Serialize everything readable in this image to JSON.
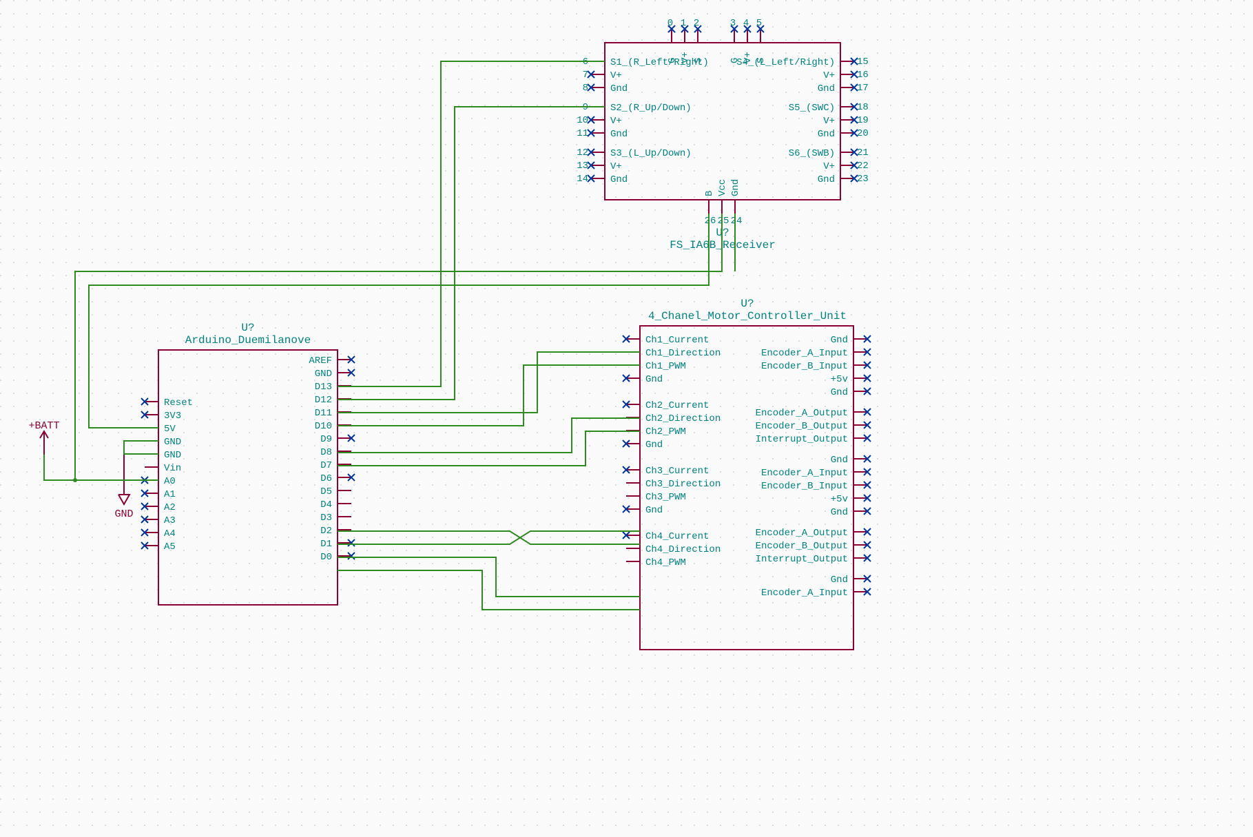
{
  "colors": {
    "bg": "#fafafa",
    "outline": "#8B0033",
    "pin_text": "#008080",
    "wire": "#2E8B1F",
    "nc": "#00349B"
  },
  "power_labels": {
    "batt": "+BATT",
    "gnd": "GND"
  },
  "components": {
    "arduino": {
      "ref": "U?",
      "value": "Arduino_Duemilanove",
      "left_pins": [
        "Reset",
        "3V3",
        "5V",
        "GND",
        "GND",
        "Vin",
        "A0",
        "A1",
        "A2",
        "A3",
        "A4",
        "A5"
      ],
      "right_pins": [
        "AREF",
        "GND",
        "D13",
        "D12",
        "D11",
        "D10",
        "D9",
        "D8",
        "D7",
        "D6",
        "D5",
        "D4",
        "D3",
        "D2",
        "D1",
        "D0"
      ]
    },
    "receiver": {
      "ref": "U?",
      "value": "FS_IA6B_Receiver",
      "top_labels_left": [
        "G",
        "V+",
        "S"
      ],
      "top_labels_right": [
        "G",
        "V+",
        "S"
      ],
      "top_pin_nums_left": [
        "0",
        "1",
        "2"
      ],
      "top_pin_nums_right": [
        "3",
        "4",
        "5"
      ],
      "bottom_labels": [
        "B",
        "Vcc",
        "Gnd"
      ],
      "bottom_pin_nums": [
        "26",
        "25",
        "24"
      ],
      "left_groups": [
        {
          "name": "S1_(R_Left/Right)",
          "num": "6"
        },
        {
          "name": "V+",
          "num": "7"
        },
        {
          "name": "Gnd",
          "num": "8"
        },
        {
          "name": "S2_(R_Up/Down)",
          "num": "9"
        },
        {
          "name": "V+",
          "num": "10"
        },
        {
          "name": "Gnd",
          "num": "11"
        },
        {
          "name": "S3_(L_Up/Down)",
          "num": "12"
        },
        {
          "name": "V+",
          "num": "13"
        },
        {
          "name": "Gnd",
          "num": "14"
        }
      ],
      "right_groups": [
        {
          "name": "S4_(L_Left/Right)",
          "num": "15"
        },
        {
          "name": "V+",
          "num": "16"
        },
        {
          "name": "Gnd",
          "num": "17"
        },
        {
          "name": "S5_(SWC)",
          "num": "18"
        },
        {
          "name": "V+",
          "num": "19"
        },
        {
          "name": "Gnd",
          "num": "20"
        },
        {
          "name": "S6_(SWB)",
          "num": "21"
        },
        {
          "name": "V+",
          "num": "22"
        },
        {
          "name": "Gnd",
          "num": "23"
        }
      ]
    },
    "motor_ctrl": {
      "ref": "U?",
      "value": "4_Chanel_Motor_Controller_Unit",
      "left_groups": [
        "Ch1_Current",
        "Ch1_Direction",
        "Ch1_PWM",
        "Gnd",
        "Ch2_Current",
        "Ch2_Direction",
        "Ch2_PWM",
        "Gnd",
        "Ch3_Current",
        "Ch3_Direction",
        "Ch3_PWM",
        "Gnd",
        "Ch4_Current",
        "Ch4_Direction",
        "Ch4_PWM"
      ],
      "right_groups": [
        "Gnd",
        "Encoder_A_Input",
        "Encoder_B_Input",
        "+5v",
        "Gnd",
        "Encoder_A_Output",
        "Encoder_B_Output",
        "Interrupt_Output",
        "Gnd",
        "Encoder_A_Input",
        "Encoder_B_Input",
        "+5v",
        "Gnd",
        "Encoder_A_Output",
        "Encoder_B_Output",
        "Interrupt_Output",
        "Gnd",
        "Encoder_A_Input"
      ],
      "left_gap_after": [
        3,
        7,
        11
      ],
      "right_gap_after": [
        4,
        7,
        12,
        15
      ]
    }
  }
}
